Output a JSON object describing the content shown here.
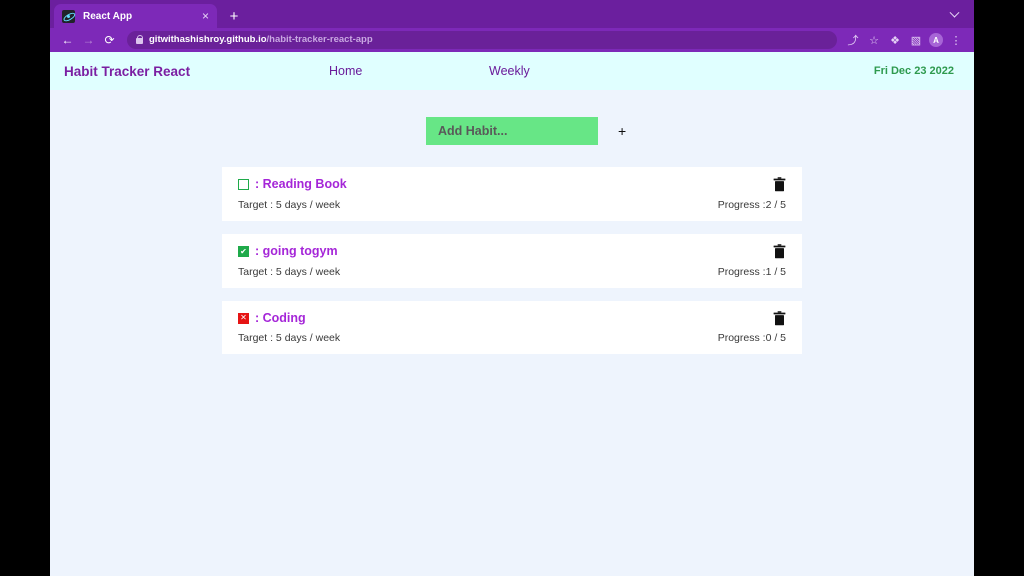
{
  "browser": {
    "tab": {
      "title": "React App",
      "favicon": "react-logo-icon",
      "close": "×"
    },
    "new_tab": "+",
    "tab_search": "chevron-down-icon",
    "nav": {
      "back": "←",
      "forward": "→",
      "reload": "⟳"
    },
    "omnibox": {
      "secure_icon": "lock-icon",
      "url_domain": "gitwithashishroy.github.io",
      "url_path": "/habit-tracker-react-app"
    },
    "toolbar_icons": [
      {
        "name": "share-icon",
        "glyph": "⤴"
      },
      {
        "name": "bookmark-star-icon",
        "glyph": "☆"
      },
      {
        "name": "extensions-puzzle-icon",
        "glyph": "❖"
      },
      {
        "name": "side-panel-icon",
        "glyph": "▧"
      },
      {
        "name": "profile-avatar",
        "glyph": "A"
      },
      {
        "name": "browser-menu-icon",
        "glyph": "⋮"
      }
    ]
  },
  "app": {
    "brand": "Habit Tracker React",
    "nav": {
      "home": "Home",
      "weekly": "Weekly"
    },
    "today": "Fri Dec 23 2022",
    "add_habit": {
      "placeholder": "Add Habit...",
      "value": "",
      "add_button": "+"
    },
    "habits": [
      {
        "state": "empty",
        "state_glyph": "",
        "name": ": Reading Book",
        "target": "Target : 5 days / week",
        "progress": "Progress :2 / 5",
        "delete_icon": "trash-icon"
      },
      {
        "state": "checked",
        "state_glyph": "✔",
        "name": ": going togym",
        "target": "Target : 5 days / week",
        "progress": "Progress :1 / 5",
        "delete_icon": "trash-icon"
      },
      {
        "state": "crossed",
        "state_glyph": "✕",
        "name": ": Coding",
        "target": "Target : 5 days / week",
        "progress": "Progress :0 / 5",
        "delete_icon": "trash-icon"
      }
    ]
  },
  "colors": {
    "browser_chrome": "#7d29b8",
    "tabstrip": "#6b1f9e",
    "app_header": "#e0ffff",
    "page_bg": "#eef4fd",
    "brand_purple": "#7b1fa2",
    "habit_purple": "#a526d8",
    "add_green": "#67e686",
    "date_green": "#2e9a4e",
    "check_green": "#1faa4a",
    "cross_red": "#e61414"
  }
}
